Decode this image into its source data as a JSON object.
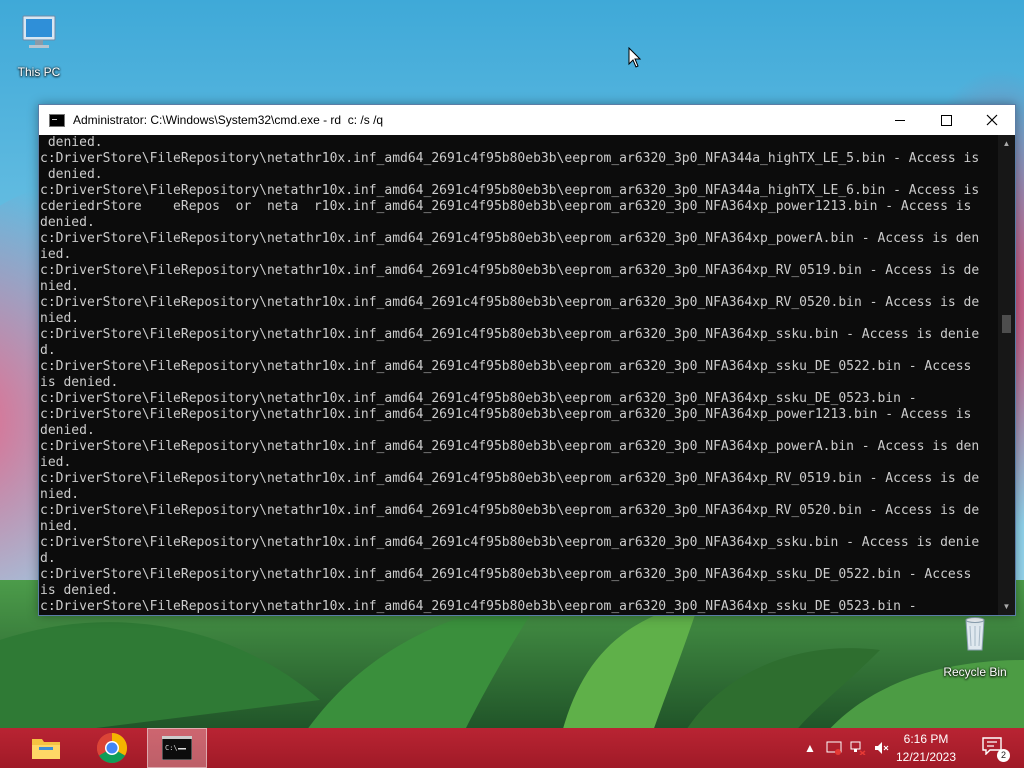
{
  "desktop": {
    "icons": [
      {
        "label": "This PC",
        "icon": "computer-icon"
      },
      {
        "label": "Recycle Bin",
        "icon": "recycle-bin-icon"
      }
    ]
  },
  "window": {
    "title": "Administrator: C:\\Windows\\System32\\cmd.exe - rd  c: /s /q",
    "icon": "cmd-icon",
    "controls": {
      "minimize": "minimize-icon",
      "maximize": "maximize-icon",
      "close": "close-icon"
    }
  },
  "console": {
    "lines": [
      " denied.",
      "c:DriverStore\\FileRepository\\netathr10x.inf_amd64_2691c4f95b80eb3b\\eeprom_ar6320_3p0_NFA344a_highTX_LE_5.bin - Access is",
      " denied.",
      "c:DriverStore\\FileRepository\\netathr10x.inf_amd64_2691c4f95b80eb3b\\eeprom_ar6320_3p0_NFA344a_highTX_LE_6.bin - Access is",
      "cderiedrStore    eRepos  or  neta  r10x.inf_amd64_2691c4f95b80eb3b\\eeprom_ar6320_3p0_NFA364xp_power1213.bin - Access is",
      "denied.",
      "c:DriverStore\\FileRepository\\netathr10x.inf_amd64_2691c4f95b80eb3b\\eeprom_ar6320_3p0_NFA364xp_powerA.bin - Access is den",
      "ied.",
      "c:DriverStore\\FileRepository\\netathr10x.inf_amd64_2691c4f95b80eb3b\\eeprom_ar6320_3p0_NFA364xp_RV_0519.bin - Access is de",
      "nied.",
      "c:DriverStore\\FileRepository\\netathr10x.inf_amd64_2691c4f95b80eb3b\\eeprom_ar6320_3p0_NFA364xp_RV_0520.bin - Access is de",
      "nied.",
      "c:DriverStore\\FileRepository\\netathr10x.inf_amd64_2691c4f95b80eb3b\\eeprom_ar6320_3p0_NFA364xp_ssku.bin - Access is denie",
      "d.",
      "c:DriverStore\\FileRepository\\netathr10x.inf_amd64_2691c4f95b80eb3b\\eeprom_ar6320_3p0_NFA364xp_ssku_DE_0522.bin - Access",
      "is denied.",
      "c:DriverStore\\FileRepository\\netathr10x.inf_amd64_2691c4f95b80eb3b\\eeprom_ar6320_3p0_NFA364xp_ssku_DE_0523.bin -",
      "c:DriverStore\\FileRepository\\netathr10x.inf_amd64_2691c4f95b80eb3b\\eeprom_ar6320_3p0_NFA364xp_power1213.bin - Access is",
      "denied.",
      "c:DriverStore\\FileRepository\\netathr10x.inf_amd64_2691c4f95b80eb3b\\eeprom_ar6320_3p0_NFA364xp_powerA.bin - Access is den",
      "ied.",
      "c:DriverStore\\FileRepository\\netathr10x.inf_amd64_2691c4f95b80eb3b\\eeprom_ar6320_3p0_NFA364xp_RV_0519.bin - Access is de",
      "nied.",
      "c:DriverStore\\FileRepository\\netathr10x.inf_amd64_2691c4f95b80eb3b\\eeprom_ar6320_3p0_NFA364xp_RV_0520.bin - Access is de",
      "nied.",
      "c:DriverStore\\FileRepository\\netathr10x.inf_amd64_2691c4f95b80eb3b\\eeprom_ar6320_3p0_NFA364xp_ssku.bin - Access is denie",
      "d.",
      "c:DriverStore\\FileRepository\\netathr10x.inf_amd64_2691c4f95b80eb3b\\eeprom_ar6320_3p0_NFA364xp_ssku_DE_0522.bin - Access",
      "is denied.",
      "c:DriverStore\\FileRepository\\netathr10x.inf_amd64_2691c4f95b80eb3b\\eeprom_ar6320_3p0_NFA364xp_ssku_DE_0523.bin -"
    ],
    "text_color": "#cccccc",
    "background": "#0c0c0c"
  },
  "taskbar": {
    "color": "#b01f2e",
    "apps": [
      {
        "name": "File Explorer",
        "icon": "folder-icon"
      },
      {
        "name": "Google Chrome",
        "icon": "chrome-icon"
      },
      {
        "name": "Command Prompt",
        "icon": "cmd-icon",
        "active": true
      }
    ],
    "tray": {
      "icons": [
        "show-hidden-icons-chevron",
        "security-icon",
        "network-icon",
        "volume-muted-icon"
      ],
      "time": "6:16 PM",
      "date": "12/21/2023",
      "notification_count": "2"
    }
  }
}
